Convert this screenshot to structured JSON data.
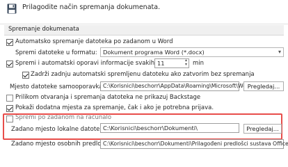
{
  "header": {
    "title": "Prilagodite način spremanja dokumenata."
  },
  "section": {
    "title": "Spremanje dokumenata"
  },
  "options": {
    "autosave_label": "Automatsko spremanje datoteka po zadanom u Word",
    "format_label": "Spremi datoteke u formatu:",
    "format_value": "Dokument programa Word (*.docx)",
    "autorecover_label": "Spremi i automatski oporavi informacije svakih",
    "autorecover_value": "11",
    "autorecover_unit": "min",
    "keep_version_label": "Zadrži zadnju automatski spremljenu datoteku ako zatvorim bez spremanja",
    "autorecover_location_label": "Mjesto datoteke samooporavka:",
    "autorecover_location_value": "C:\\Korisnici\\beschorr\\AppData\\Roaming\\Microsoft\\Word\\",
    "browse_label": "Pregledaj...",
    "no_backstage_label": "Prilikom otvaranja i spremanja datoteka ne prikazuj Backstage",
    "additional_places_label": "Pokaži dodatna mjesta za spremanje, čak i ako je potrebna prijava.",
    "save_to_computer_label": "Spremi po zadanom na računalo",
    "default_local_label": "Zadano mjesto lokalne datoteke:",
    "default_local_value": "C:\\Korisnici\\beschorr\\Dokumenti\\",
    "browse_local_label": "Pregledaj...",
    "templates_label": "Zadano mjesto osobnih predložaka:",
    "templates_value": "C:\\Korisnici\\beschorr\\Dokumenti\\Prilagođeni predlošci sustava Office\\"
  }
}
